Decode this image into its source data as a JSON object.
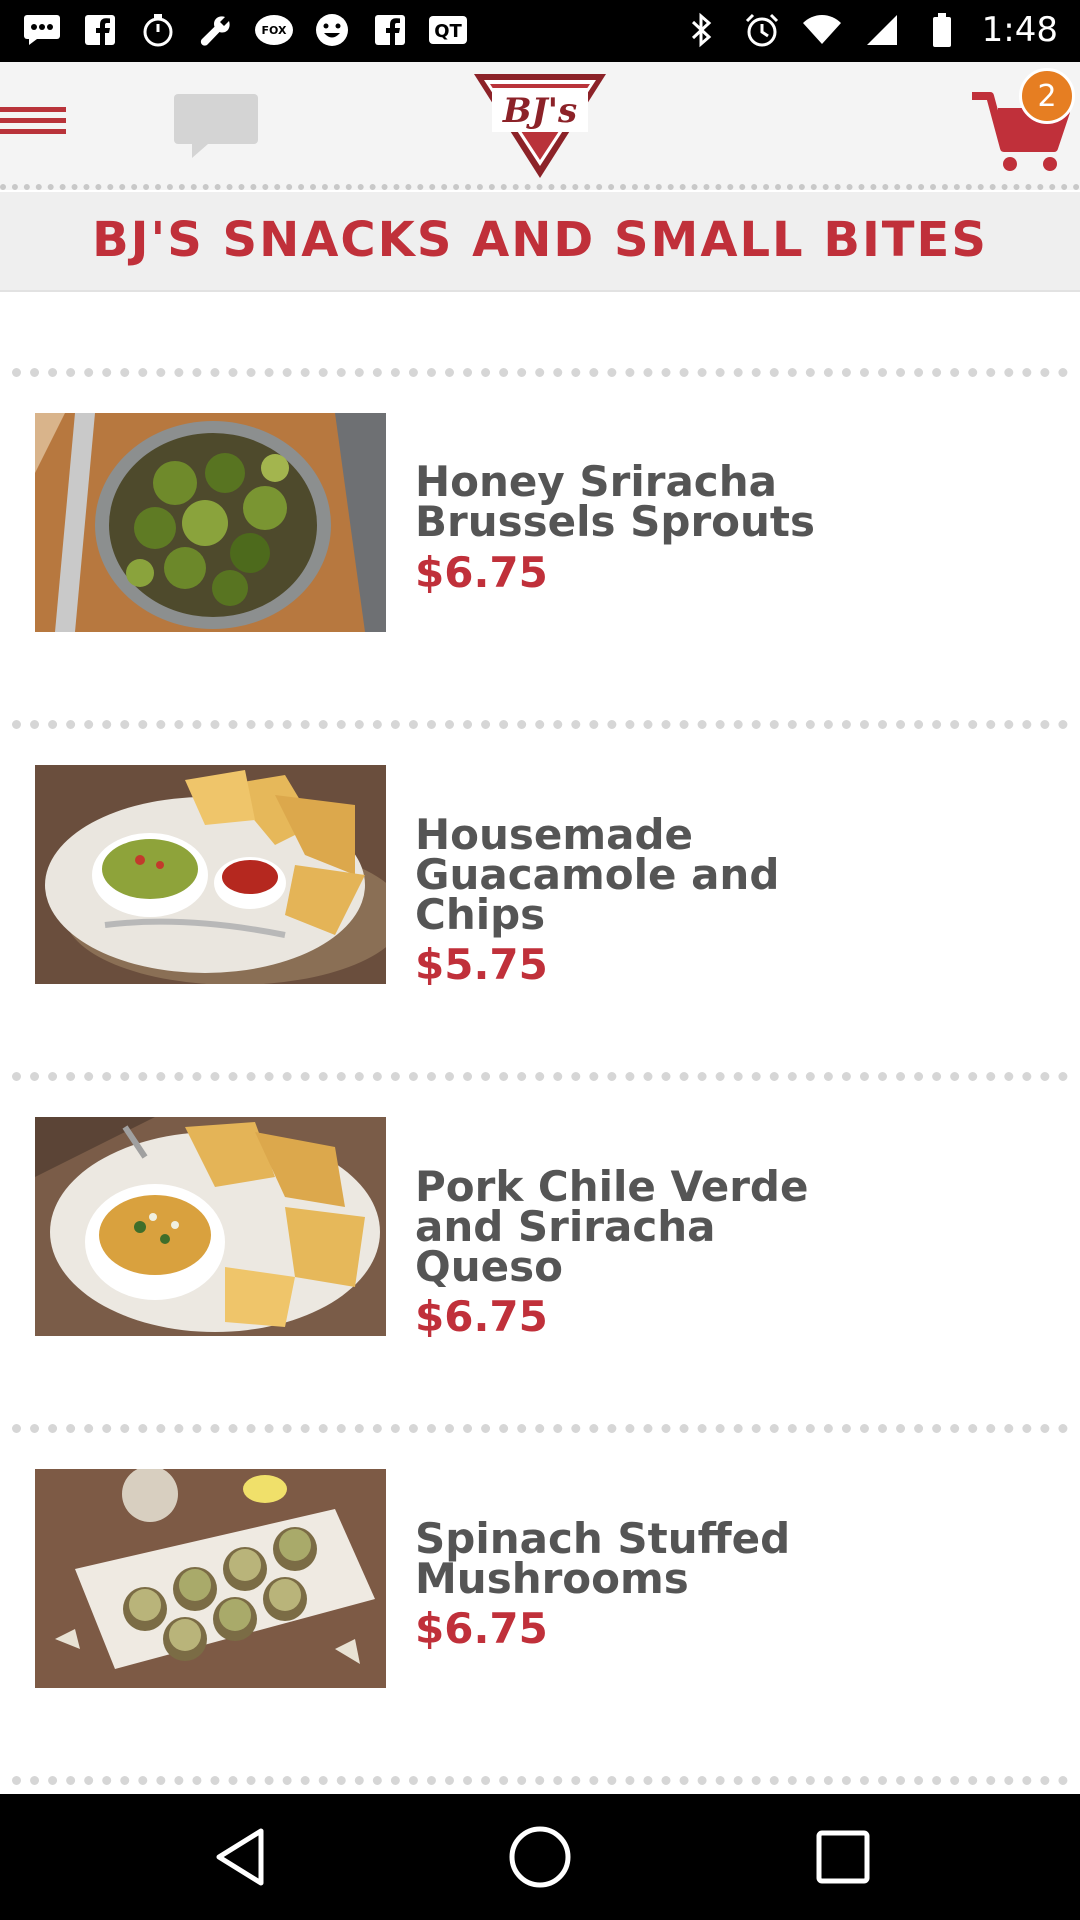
{
  "status_bar": {
    "time": "1:48",
    "icons": [
      "chat-bubble-icon",
      "facebook-icon",
      "timer-icon",
      "wrench-icon",
      "fox-sports-icon",
      "smiley-icon",
      "facebook-icon",
      "qt-icon",
      "bluetooth-icon",
      "alarm-icon",
      "wifi-icon",
      "signal-icon",
      "battery-icon"
    ],
    "fox_label": "FOX",
    "qt_label": "QT"
  },
  "header": {
    "logo_text": "BJ's",
    "cart_count": "2",
    "accent_color": "#c0303a"
  },
  "category": {
    "title": "BJ'S SNACKS AND SMALL BITES"
  },
  "menu_items": [
    {
      "name_line1": "Honey Sriracha",
      "name_line2": "Brussels Sprouts",
      "name_line3": "",
      "price": "$6.75",
      "image": "brussels-sprouts-photo"
    },
    {
      "name_line1": "Housemade",
      "name_line2": "Guacamole and",
      "name_line3": "Chips",
      "price": "$5.75",
      "image": "guacamole-chips-photo"
    },
    {
      "name_line1": "Pork Chile Verde",
      "name_line2": "and Sriracha",
      "name_line3": "Queso",
      "price": "$6.75",
      "image": "queso-chips-photo"
    },
    {
      "name_line1": "Spinach Stuffed",
      "name_line2": "Mushrooms",
      "name_line3": "",
      "price": "$6.75",
      "image": "stuffed-mushrooms-photo"
    }
  ],
  "nav_bar": {
    "buttons": [
      "back-icon",
      "home-icon",
      "recents-icon"
    ]
  }
}
